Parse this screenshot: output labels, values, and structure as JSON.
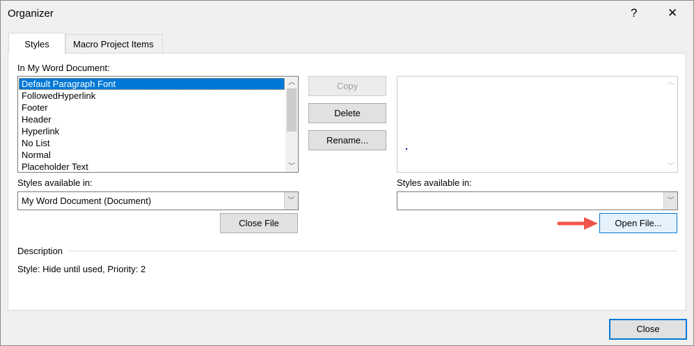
{
  "window": {
    "title": "Organizer",
    "help": "?",
    "close": "✕"
  },
  "tabs": [
    {
      "label": "Styles"
    },
    {
      "label": "Macro Project Items"
    }
  ],
  "left": {
    "label": "In My Word Document:",
    "items": [
      "Default Paragraph Font",
      "FollowedHyperlink",
      "Footer",
      "Header",
      "Hyperlink",
      "No List",
      "Normal",
      "Placeholder Text"
    ],
    "available_label": "Styles available in:",
    "available_value": "My Word Document (Document)",
    "close_file": "Close File"
  },
  "middle": {
    "copy": "Copy",
    "delete": "Delete",
    "rename": "Rename..."
  },
  "right": {
    "available_label": "Styles available in:",
    "available_value": "",
    "open_file": "Open File..."
  },
  "description": {
    "heading": "Description",
    "text": "Style: Hide until used, Priority: 2"
  },
  "footer": {
    "close": "Close"
  },
  "colors": {
    "selection": "#0078d7",
    "arrow": "#f0554a",
    "focus": "#0078d7"
  }
}
